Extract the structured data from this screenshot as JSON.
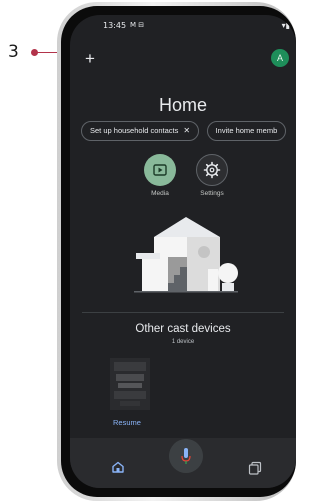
{
  "annotation": {
    "number": "3"
  },
  "status_bar": {
    "time": "13:45",
    "icons": "M ⊟"
  },
  "header": {
    "add_icon": "plus-icon",
    "avatar_initial": "A"
  },
  "main": {
    "title": "Home",
    "chips": [
      {
        "label": "Set up household contacts",
        "dismiss": "✕"
      },
      {
        "label": "Invite home memb"
      }
    ],
    "actions": [
      {
        "label": "Media",
        "icon": "media-icon",
        "color": "#89b99a"
      },
      {
        "label": "Settings",
        "icon": "gear-icon"
      }
    ]
  },
  "cast_section": {
    "title": "Other cast devices",
    "subtitle": "1 device",
    "device_action": "Resume"
  },
  "colors": {
    "background": "#202124",
    "accent": "#8ab4f8",
    "avatar": "#1e8e5a"
  }
}
